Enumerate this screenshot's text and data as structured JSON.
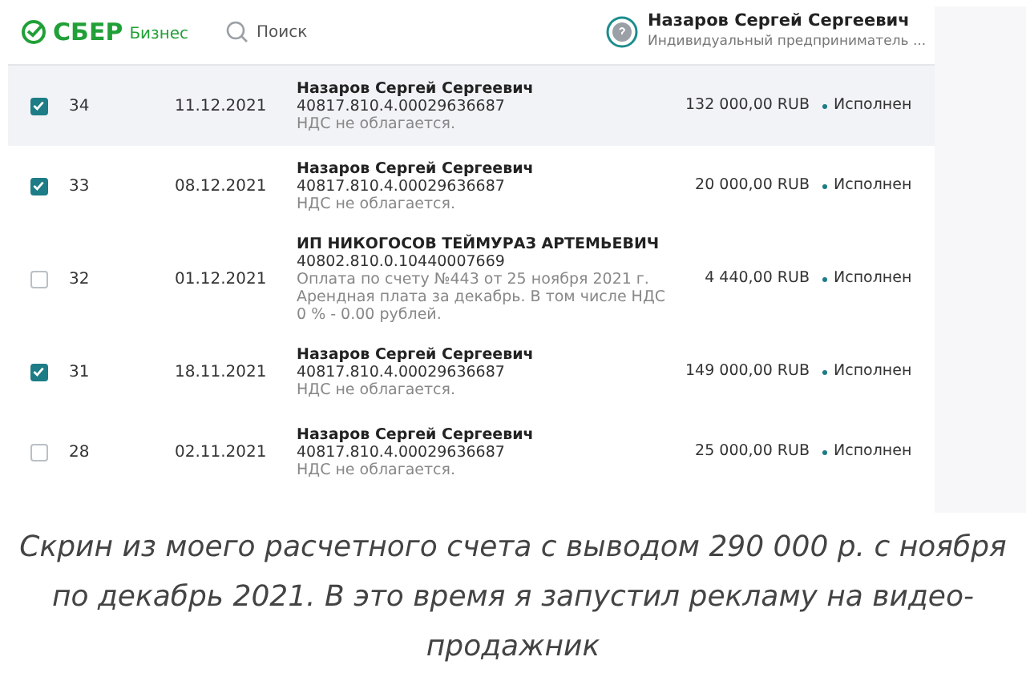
{
  "header": {
    "logo": "СБЕР",
    "logo_sub": "Бизнес",
    "search": {
      "placeholder": "Поиск"
    },
    "user": {
      "name": "Назаров Сергей Сергеевич",
      "role": "Индивидуальный предприниматель ..."
    }
  },
  "rows": [
    {
      "checked": true,
      "hovered": true,
      "number": "34",
      "date": "11.12.2021",
      "payee": "Назаров Сергей Сергеевич",
      "account": "40817.810.4.00029636687",
      "purpose": "НДС не облагается.",
      "amount": "132 000,00 RUB",
      "status": "Исполнен"
    },
    {
      "checked": true,
      "hovered": false,
      "number": "33",
      "date": "08.12.2021",
      "payee": "Назаров Сергей Сергеевич",
      "account": "40817.810.4.00029636687",
      "purpose": "НДС не облагается.",
      "amount": "20 000,00 RUB",
      "status": "Исполнен"
    },
    {
      "checked": false,
      "hovered": false,
      "number": "32",
      "date": "01.12.2021",
      "payee": "ИП НИКОГОСОВ ТЕЙМУРАЗ АРТЕМЬЕВИЧ",
      "account": "40802.810.0.10440007669",
      "purpose": "Оплата по счету №443 от 25 ноября 2021 г. Арендная плата за декабрь. В том числе НДС 0 % - 0.00 рублей.",
      "amount": "4 440,00 RUB",
      "status": "Исполнен"
    },
    {
      "checked": true,
      "hovered": false,
      "number": "31",
      "date": "18.11.2021",
      "payee": "Назаров Сергей Сергеевич",
      "account": "40817.810.4.00029636687",
      "purpose": "НДС не облагается.",
      "amount": "149 000,00 RUB",
      "status": "Исполнен"
    },
    {
      "checked": false,
      "hovered": false,
      "number": "28",
      "date": "02.11.2021",
      "payee": "Назаров Сергей Сергеевич",
      "account": "40817.810.4.00029636687",
      "purpose": "НДС не облагается.",
      "amount": "25 000,00 RUB",
      "status": "Исполнен"
    }
  ],
  "caption": "Скрин из моего расчетного счета с выводом 290 000 р. с ноября по декабрь 2021. В это время я запустил рекламу на видео-продажник"
}
